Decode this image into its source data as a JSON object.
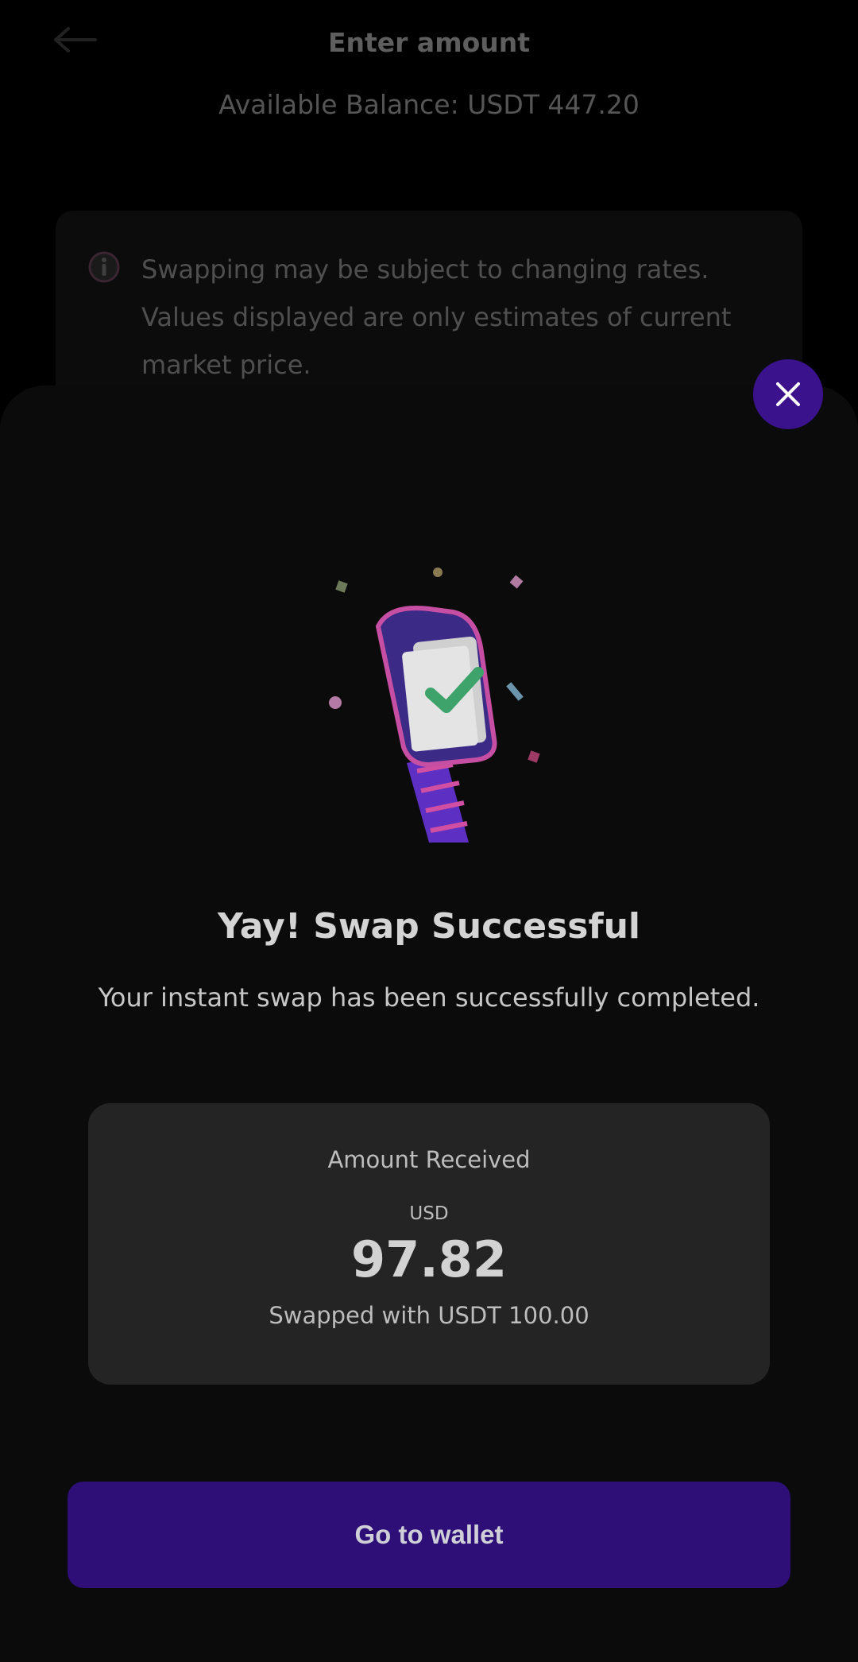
{
  "colors": {
    "accent": "#3a128c",
    "button": "#2e0e77",
    "sheet": "#0b0b0b",
    "card": "#242424",
    "check": "#3ea36a",
    "strap": "#5d2fc2",
    "strap_accent": "#d14fa3"
  },
  "background": {
    "back_icon": "arrow-left-icon",
    "title": "Enter amount",
    "balance": "Available Balance: USDT 447.20",
    "info_icon": "info-icon",
    "info_text": "Swapping may be subject to changing rates. Values displayed are only estimates of current market price."
  },
  "modal": {
    "close_icon": "close-icon",
    "illustration": "fitness-band-checkmark-illustration",
    "headline": "Yay! Swap Successful",
    "subline": "Your instant swap has been successfully completed.",
    "card": {
      "label": "Amount Received",
      "currency": "USD",
      "value": "97.82",
      "swapped": "Swapped with USDT 100.00"
    },
    "button_label": "Go to wallet"
  }
}
